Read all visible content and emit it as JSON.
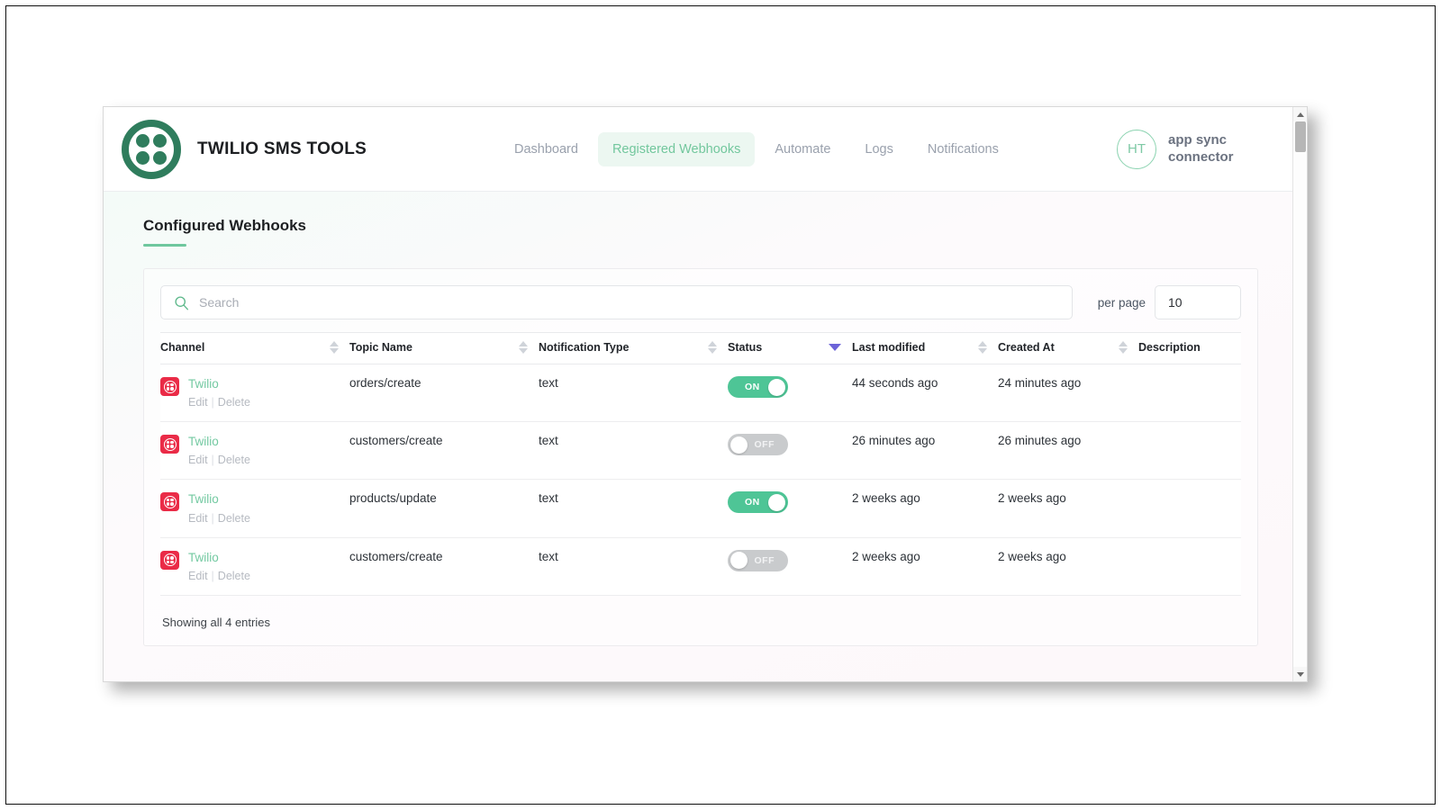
{
  "header": {
    "brand_title": "TWILIO SMS TOOLS",
    "logo_icon": "twilio-logo-icon",
    "nav": [
      {
        "label": "Dashboard",
        "active": false
      },
      {
        "label": "Registered Webhooks",
        "active": true
      },
      {
        "label": "Automate",
        "active": false
      },
      {
        "label": "Logs",
        "active": false
      },
      {
        "label": "Notifications",
        "active": false
      }
    ],
    "user": {
      "avatar_initials": "HT",
      "name": "app sync connector"
    }
  },
  "page": {
    "title": "Configured Webhooks"
  },
  "toolbar": {
    "search_placeholder": "Search",
    "search_value": "",
    "search_icon": "search-icon",
    "per_page_label": "per page",
    "per_page_value": "10"
  },
  "table": {
    "columns": [
      {
        "label": "Channel",
        "sortable": true,
        "sort_state": "none"
      },
      {
        "label": "Topic Name",
        "sortable": true,
        "sort_state": "none"
      },
      {
        "label": "Notification Type",
        "sortable": true,
        "sort_state": "none"
      },
      {
        "label": "Status",
        "sortable": true,
        "sort_state": "desc"
      },
      {
        "label": "Last modified",
        "sortable": true,
        "sort_state": "none"
      },
      {
        "label": "Created At",
        "sortable": true,
        "sort_state": "none"
      },
      {
        "label": "Description",
        "sortable": false,
        "sort_state": "none"
      }
    ],
    "row_actions": {
      "edit": "Edit",
      "delete": "Delete",
      "separator": "|"
    },
    "rows": [
      {
        "channel": "Twilio",
        "channel_icon": "twilio-channel-icon",
        "topic_name": "orders/create",
        "notification_type": "text",
        "status": "ON",
        "status_on": true,
        "last_modified": "44 seconds ago",
        "created_at": "24 minutes ago",
        "description": ""
      },
      {
        "channel": "Twilio",
        "channel_icon": "twilio-channel-icon",
        "topic_name": "customers/create",
        "notification_type": "text",
        "status": "OFF",
        "status_on": false,
        "last_modified": "26 minutes ago",
        "created_at": "26 minutes ago",
        "description": ""
      },
      {
        "channel": "Twilio",
        "channel_icon": "twilio-channel-icon",
        "topic_name": "products/update",
        "notification_type": "text",
        "status": "ON",
        "status_on": true,
        "last_modified": "2 weeks ago",
        "created_at": "2 weeks ago",
        "description": ""
      },
      {
        "channel": "Twilio",
        "channel_icon": "twilio-channel-icon",
        "topic_name": "customers/create",
        "notification_type": "text",
        "status": "OFF",
        "status_on": false,
        "last_modified": "2 weeks ago",
        "created_at": "2 weeks ago",
        "description": ""
      }
    ],
    "footer_text": "Showing all 4 entries"
  },
  "colors": {
    "brand_green": "#2f7d5d",
    "accent_green": "#6fc79e",
    "toggle_on": "#4ec596",
    "toggle_off": "#c9cbcd",
    "channel_red": "#ea2b47",
    "sort_active": "#6c63d8",
    "nav_active_bg": "#ecf7f1",
    "decor_blue": "#e8ecf9"
  }
}
